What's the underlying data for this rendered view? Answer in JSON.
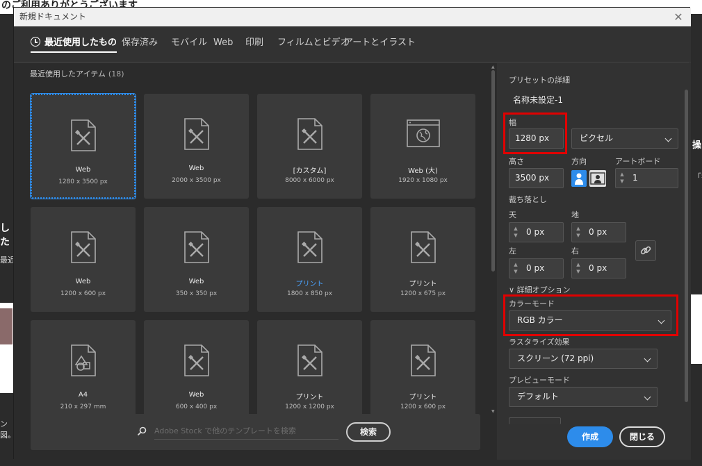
{
  "background": {
    "top_text": "のご利用ありがとうございます",
    "left_texts": [
      "した",
      "最近",
      "ン図。"
    ],
    "right_texts": [
      "操",
      "「学"
    ]
  },
  "dialog": {
    "title": "新規ドキュメント",
    "close_glyph": "✕",
    "tabs": [
      {
        "label": "最近使用したもの",
        "active": true
      },
      {
        "label": "保存済み"
      },
      {
        "label": "モバイル"
      },
      {
        "label": "Web"
      },
      {
        "label": "印刷"
      },
      {
        "label": "フィルムとビデオ"
      },
      {
        "label": "アートとイラスト"
      }
    ],
    "recent": {
      "title": "最近使用したアイテム",
      "count": "(18)",
      "items": [
        {
          "name": "Web",
          "size": "1280 x 3500 px",
          "icon": "pencil-document-icon",
          "selected": true
        },
        {
          "name": "Web",
          "size": "2000 x 3500 px",
          "icon": "pencil-document-icon"
        },
        {
          "name": "[カスタム]",
          "size": "8000 x 6000 px",
          "icon": "pencil-document-icon"
        },
        {
          "name": "Web (大)",
          "size": "1920 x 1080 px",
          "icon": "web-globe-icon"
        },
        {
          "name": "Web",
          "size": "1200 x 600 px",
          "icon": "pencil-document-icon"
        },
        {
          "name": "Web",
          "size": "350 x 350 px",
          "icon": "pencil-document-icon"
        },
        {
          "name": "プリント",
          "size": "1800 x 850 px",
          "icon": "pencil-document-icon",
          "blue": true
        },
        {
          "name": "プリント",
          "size": "1200 x 675 px",
          "icon": "pencil-document-icon"
        },
        {
          "name": "A4",
          "size": "210 x 297 mm",
          "icon": "shapes-document-icon"
        },
        {
          "name": "Web",
          "size": "600 x 400 px",
          "icon": "pencil-document-icon"
        },
        {
          "name": "プリント",
          "size": "1200 x 1200 px",
          "icon": "pencil-document-icon"
        },
        {
          "name": "プリント",
          "size": "1200 x 600 px",
          "icon": "pencil-document-icon"
        }
      ]
    },
    "search": {
      "placeholder": "Adobe Stock で他のテンプレートを検索",
      "button": "検索"
    },
    "preset": {
      "header": "プリセットの詳細",
      "name": "名称未設定-1",
      "width_label": "幅",
      "width_value": "1280 px",
      "unit": "ピクセル",
      "height_label": "高さ",
      "height_value": "3500 px",
      "orientation_label": "方向",
      "artboard_label": "アートボード",
      "artboard_value": "1",
      "bleed_label": "裁ち落とし",
      "top_label": "天",
      "top_value": "0 px",
      "bottom_label": "地",
      "bottom_value": "0 px",
      "left_label": "左",
      "left_value": "0 px",
      "right_label": "右",
      "right_value": "0 px",
      "advanced_label": "詳細オプション",
      "color_mode_label": "カラーモード",
      "color_mode_value": "RGB カラー",
      "raster_label": "ラスタライズ効果",
      "raster_value": "スクリーン (72 ppi)",
      "preview_label": "プレビューモード",
      "preview_value": "デフォルト"
    },
    "buttons": {
      "create": "作成",
      "close": "閉じる"
    }
  },
  "colors": {
    "accent": "#2d8ceb",
    "highlight": "#e10000"
  }
}
